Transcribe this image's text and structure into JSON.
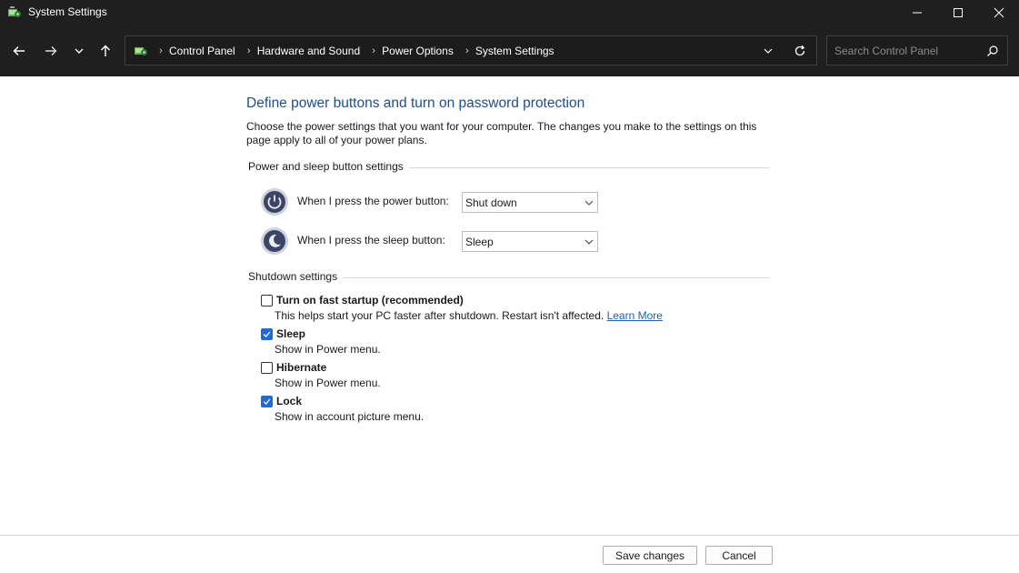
{
  "window": {
    "title": "System Settings",
    "icons": {
      "app": "control-panel-icon",
      "minimize": "minimize-icon",
      "maximize": "maximize-icon",
      "close": "close-icon"
    }
  },
  "nav": {
    "icons": [
      "back-arrow-icon",
      "forward-arrow-icon",
      "recent-locations-chevron-icon",
      "up-arrow-icon"
    ],
    "breadcrumbs": [
      "Control Panel",
      "Hardware and Sound",
      "Power Options",
      "System Settings"
    ],
    "search_placeholder": "Search Control Panel"
  },
  "page": {
    "heading": "Define power buttons and turn on password protection",
    "description": "Choose the power settings that you want for your computer. The changes you make to the settings on this page apply to all of your power plans.",
    "power_section": {
      "title": "Power and sleep button settings",
      "power_button": {
        "label": "When I press the power button:",
        "value": "Shut down"
      },
      "sleep_button": {
        "label": "When I press the sleep button:",
        "value": "Sleep"
      }
    },
    "shutdown_section": {
      "title": "Shutdown settings",
      "items": [
        {
          "label": "Turn on fast startup (recommended)",
          "checked": false,
          "description": "This helps start your PC faster after shutdown. Restart isn't affected.",
          "link": "Learn More"
        },
        {
          "label": "Sleep",
          "checked": true,
          "description": "Show in Power menu."
        },
        {
          "label": "Hibernate",
          "checked": false,
          "description": "Show in Power menu."
        },
        {
          "label": "Lock",
          "checked": true,
          "description": "Show in account picture menu."
        }
      ]
    }
  },
  "footer": {
    "save_label": "Save changes",
    "cancel_label": "Cancel"
  },
  "colors": {
    "titlebar_bg": "#1f1f1f",
    "heading": "#1e4e8c",
    "link": "#1e62b0",
    "checkbox_checked": "#1f6bd6"
  }
}
